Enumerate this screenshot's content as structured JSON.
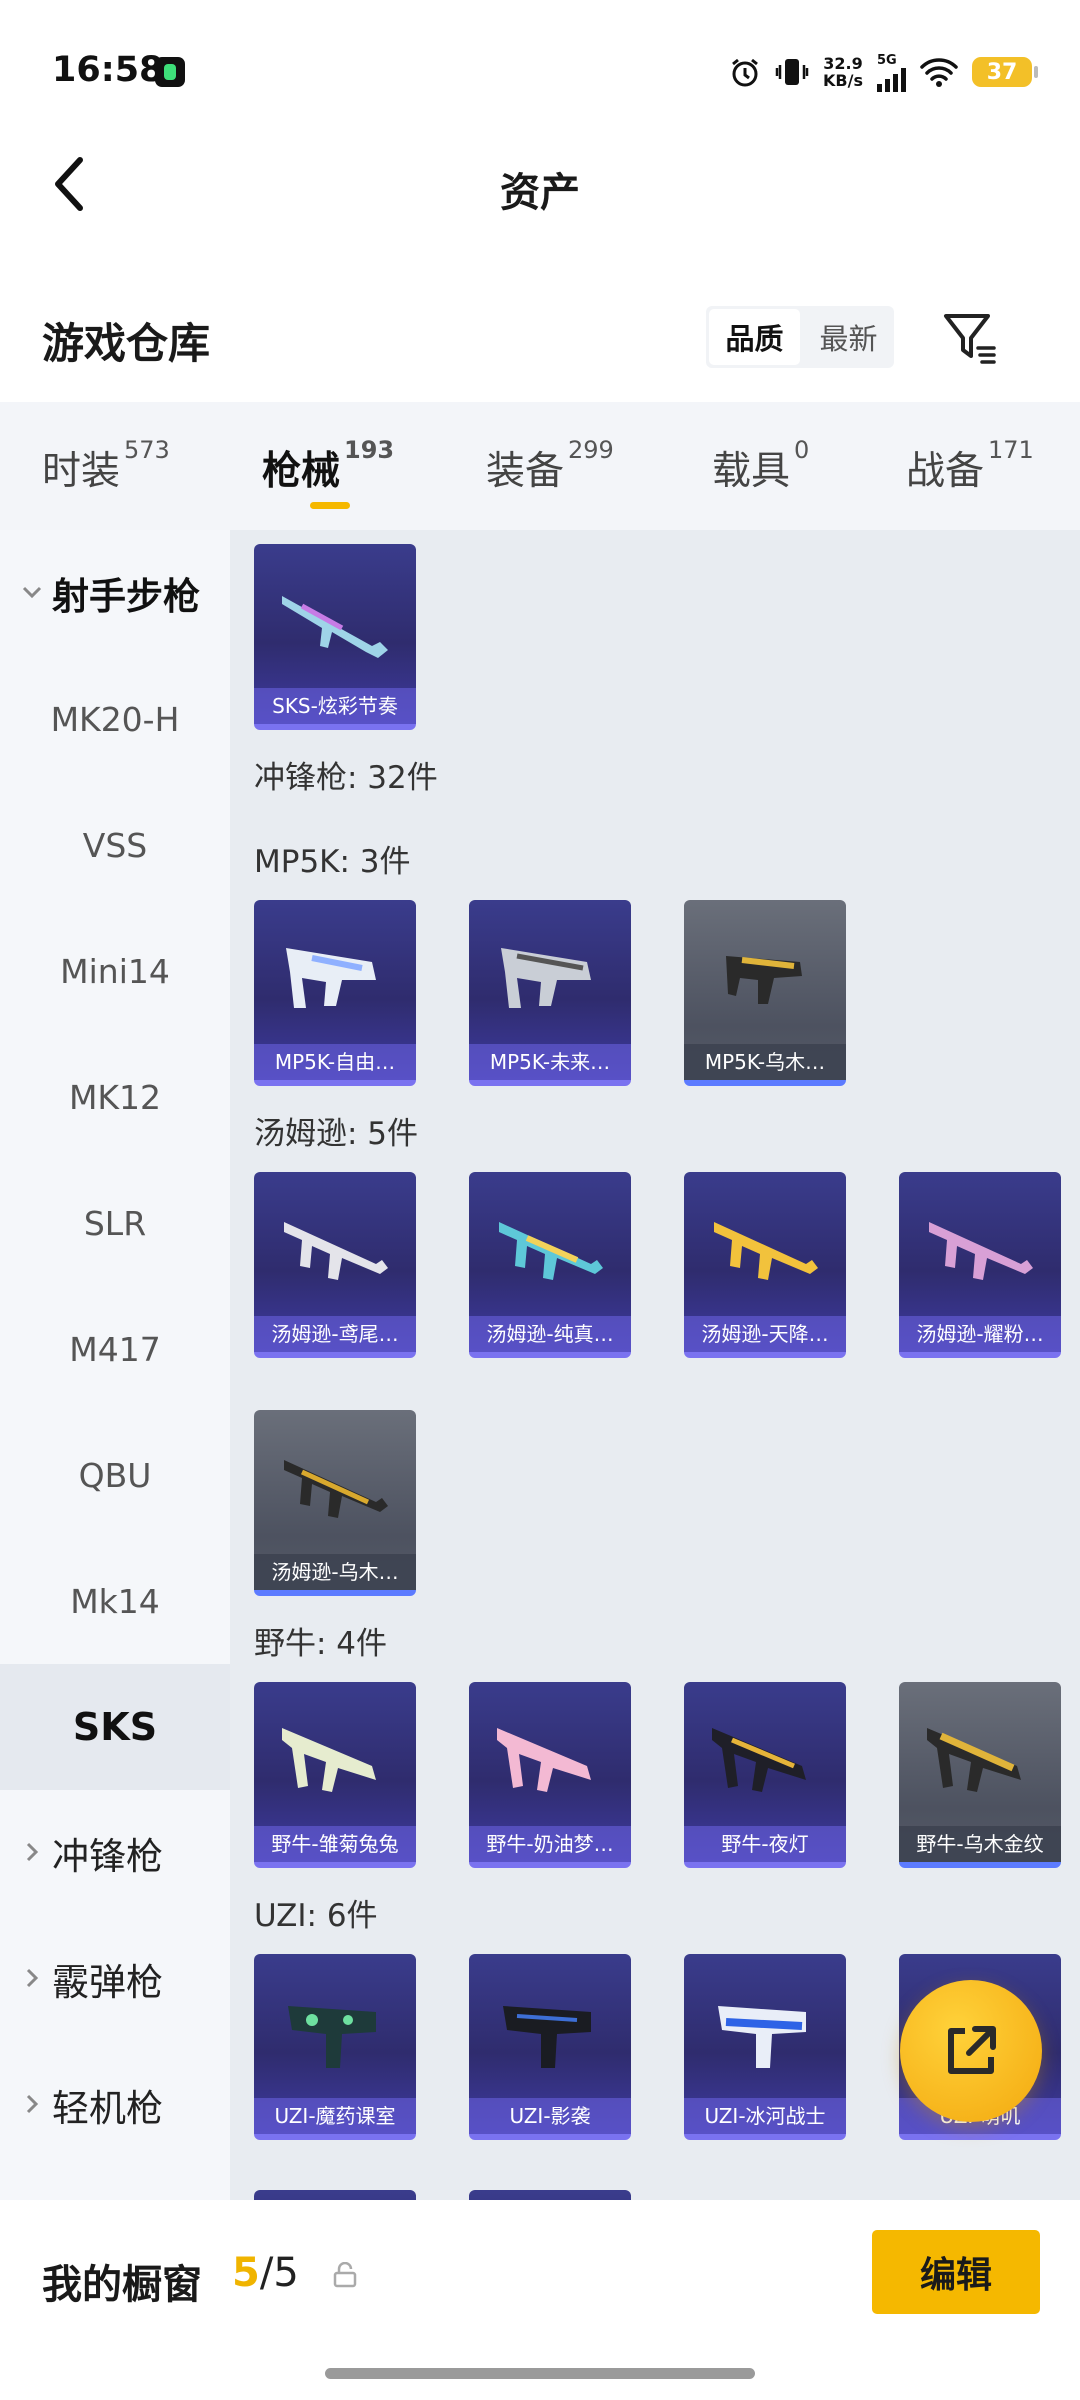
{
  "status": {
    "time": "16:58",
    "net_speed": "32.9",
    "net_unit": "KB/s",
    "signal": "5G",
    "battery": "37"
  },
  "header": {
    "title": "资产"
  },
  "warehouse": {
    "title": "游戏仓库",
    "sort_quality": "品质",
    "sort_newest": "最新",
    "active_sort": "品质"
  },
  "tabs": [
    {
      "label": "时装",
      "count": "573"
    },
    {
      "label": "枪械",
      "count": "193",
      "active": true
    },
    {
      "label": "装备",
      "count": "299"
    },
    {
      "label": "载具",
      "count": "0"
    },
    {
      "label": "战备",
      "count": "171"
    }
  ],
  "sidebar": {
    "category_open": "射手步枪",
    "items": [
      "MK20-H",
      "VSS",
      "Mini14",
      "MK12",
      "SLR",
      "M417",
      "QBU",
      "Mk14",
      "SKS"
    ],
    "selected": "SKS",
    "categories": [
      "冲锋枪",
      "霰弹枪",
      "轻机枪"
    ]
  },
  "content": {
    "first_card": "SKS-炫彩节奏",
    "smg_total": "冲锋枪: 32件",
    "groups": [
      {
        "label": "MP5K: 3件",
        "cards": [
          "MP5K-自由…",
          "MP5K-未来…",
          "MP5K-乌木…"
        ]
      },
      {
        "label": "汤姆逊: 5件",
        "cards": [
          "汤姆逊-鸢尾…",
          "汤姆逊-纯真…",
          "汤姆逊-天降…",
          "汤姆逊-耀粉…",
          "汤姆逊-乌木…"
        ]
      },
      {
        "label": "野牛: 4件",
        "cards": [
          "野牛-雏菊兔兔",
          "野牛-奶油梦…",
          "野牛-夜灯",
          "野牛-乌木金纹"
        ]
      },
      {
        "label": "UZI: 6件",
        "cards": [
          "UZI-魔药课室",
          "UZI-影袭",
          "UZI-冰河战士",
          "UZI-萌叽"
        ]
      }
    ]
  },
  "bottom": {
    "label": "我的橱窗",
    "current": "5",
    "separator": "/",
    "max": "5",
    "edit": "编辑"
  },
  "colors": {
    "accent": "#f5b800",
    "card_purple": "#3a3c8c",
    "card_grey": "#5a5f6b"
  },
  "icons": [
    "back-arrow-icon",
    "filter-icon",
    "chevron-down-icon",
    "chevron-right-icon",
    "share-icon",
    "lock-icon",
    "alarm-icon",
    "vibrate-icon",
    "wifi-icon"
  ]
}
